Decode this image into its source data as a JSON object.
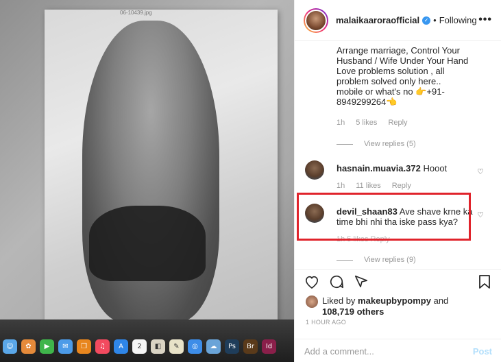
{
  "photo": {
    "filename": "06-10439.jpg"
  },
  "dock": {
    "icons": [
      {
        "name": "finder-icon",
        "glyph": "☺",
        "color": "#5aa7e8"
      },
      {
        "name": "photos-icon",
        "glyph": "✿",
        "color": "#e58a3a"
      },
      {
        "name": "facetime-icon",
        "glyph": "▶",
        "color": "#3fb54b"
      },
      {
        "name": "messages-icon",
        "glyph": "✉",
        "color": "#4c9be8"
      },
      {
        "name": "books-icon",
        "glyph": "❒",
        "color": "#e8861e"
      },
      {
        "name": "music-icon",
        "glyph": "♫",
        "color": "#f24a5f"
      },
      {
        "name": "appstore-icon",
        "glyph": "A",
        "color": "#2f86e8"
      },
      {
        "name": "calendar-icon",
        "glyph": "2",
        "color": "#f5f5f5"
      },
      {
        "name": "preview-icon",
        "glyph": "◧",
        "color": "#d9d3c4"
      },
      {
        "name": "notes-icon",
        "glyph": "✎",
        "color": "#e8e2c8"
      },
      {
        "name": "safari-icon",
        "glyph": "◎",
        "color": "#3d8de8"
      },
      {
        "name": "cloud-icon",
        "glyph": "☁",
        "color": "#6aa4d8"
      },
      {
        "name": "photoshop-icon",
        "glyph": "Ps",
        "color": "#1f3d5a"
      },
      {
        "name": "bridge-icon",
        "glyph": "Br",
        "color": "#5a3a1a"
      },
      {
        "name": "indesign-icon",
        "glyph": "Id",
        "color": "#8a1f4a"
      }
    ]
  },
  "header": {
    "username": "malaikaaroraofficial",
    "separator": "•",
    "follow_status": "Following",
    "more": "•••"
  },
  "comments": {
    "first": {
      "lines": [
        "Arrange marriage, Control Your",
        "Husband / Wife Under Your Hand",
        "Love problems solution , all",
        "problem solved only here..",
        "mobile or what's no 👉+91-",
        "8949299264👈"
      ],
      "time": "1h",
      "likes": "5 likes",
      "reply": "Reply",
      "view_replies": "View replies (5)"
    },
    "second": {
      "username": "hasnain.muavia.372",
      "text": "Hooot",
      "time": "1h",
      "likes": "11 likes",
      "reply": "Reply"
    },
    "third": {
      "username": "devil_shaan83",
      "text_line1": "Ave shave krne ka",
      "text_line2": "time bhi nhi tha iske pass kya?",
      "meta_partial": "1h    5 likes    Reply",
      "view_replies": "View replies (9)"
    }
  },
  "actions": {
    "liked_by_prefix": "Liked by",
    "liked_by_user": "makeupbypompy",
    "liked_by_and": "and",
    "others": "108,719 others",
    "timestamp": "1 HOUR AGO"
  },
  "add_comment": {
    "placeholder": "Add a comment...",
    "post_label": "Post"
  },
  "colors": {
    "highlight": "#e0232b",
    "verified": "#3897f0",
    "post_disabled": "#b2dffc"
  }
}
